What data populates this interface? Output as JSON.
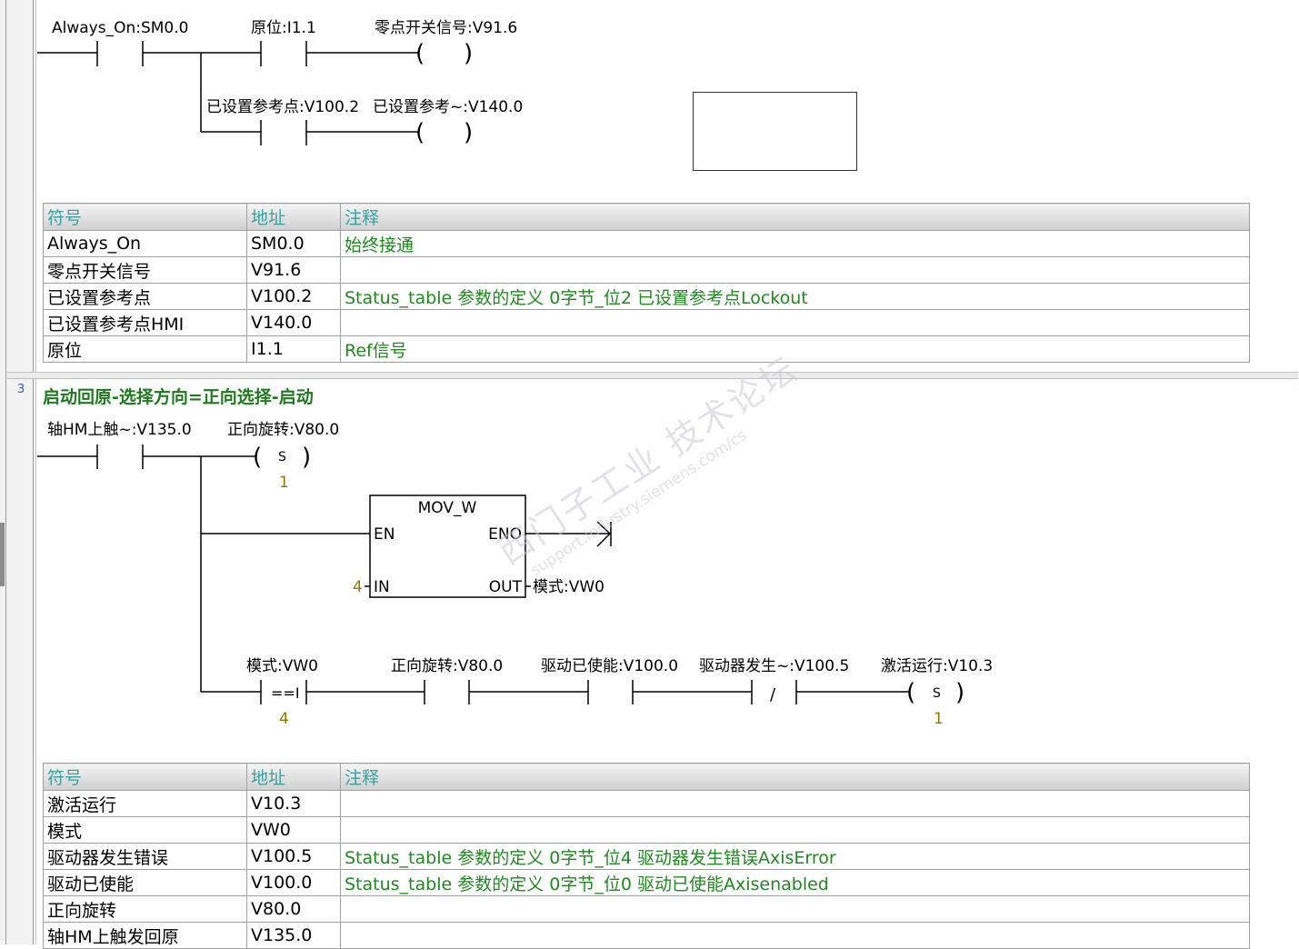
{
  "network2": {
    "rung1": {
      "contact1_label": "Always_On:SM0.0",
      "contact2_label": "原位:I1.1",
      "coil1_label": "零点开关信号:V91.6"
    },
    "rung2": {
      "contact_label": "已设置参考点:V100.2",
      "coil_label": "已设置参考~:V140.0"
    },
    "symbol_table": {
      "headers": [
        "符号",
        "地址",
        "注释"
      ],
      "rows": [
        {
          "symbol": "Always_On",
          "address": "SM0.0",
          "comment": "始终接通"
        },
        {
          "symbol": "零点开关信号",
          "address": "V91.6",
          "comment": ""
        },
        {
          "symbol": "已设置参考点",
          "address": "V100.2",
          "comment": "Status_table 参数的定义 0字节_位2 已设置参考点Lockout"
        },
        {
          "symbol": "已设置参考点HMI",
          "address": "V140.0",
          "comment": ""
        },
        {
          "symbol": "原位",
          "address": "I1.1",
          "comment": "Ref信号"
        }
      ]
    }
  },
  "network3": {
    "number": "3",
    "title": "启动回原-选择方向=正向选择-启动",
    "contact_label": "轴HM上触~:V135.0",
    "set_coil": {
      "label": "正向旋转:V80.0",
      "type": "S",
      "count": "1"
    },
    "mov_block": {
      "name": "MOV_W",
      "en": "EN",
      "eno": "ENO",
      "in": "IN",
      "out": "OUT",
      "in_value": "4",
      "out_value": "模式:VW0"
    },
    "rung3": {
      "compare_label": "模式:VW0",
      "compare_op": "==I",
      "compare_value": "4",
      "contact2_label": "正向旋转:V80.0",
      "contact3_label": "驱动已使能:V100.0",
      "contact4_label": "驱动器发生~:V100.5",
      "contact4_symbol": "/",
      "coil_label": "激活运行:V10.3",
      "coil_type": "S",
      "coil_count": "1"
    },
    "symbol_table": {
      "headers": [
        "符号",
        "地址",
        "注释"
      ],
      "rows": [
        {
          "symbol": "激活运行",
          "address": "V10.3",
          "comment": ""
        },
        {
          "symbol": "模式",
          "address": "VW0",
          "comment": ""
        },
        {
          "symbol": "驱动器发生错误",
          "address": "V100.5",
          "comment": "Status_table 参数的定义 0字节_位4 驱动器发生错误AxisError"
        },
        {
          "symbol": "驱动已使能",
          "address": "V100.0",
          "comment": "Status_table 参数的定义 0字节_位0 驱动已使能Axisenabled"
        },
        {
          "symbol": "正向旋转",
          "address": "V80.0",
          "comment": ""
        },
        {
          "symbol": "轴HM上触发回原",
          "address": "V135.0",
          "comment": ""
        }
      ]
    }
  },
  "watermark": {
    "line1": "西门子工业 技术论坛",
    "line2": "support.industry.siemens.com/cs"
  },
  "colors": {
    "comment_green": "#1f8a1f",
    "header_teal": "#3aa0a0",
    "counter_olive": "#8a7a00",
    "network_title_green": "#1f7a1f"
  }
}
